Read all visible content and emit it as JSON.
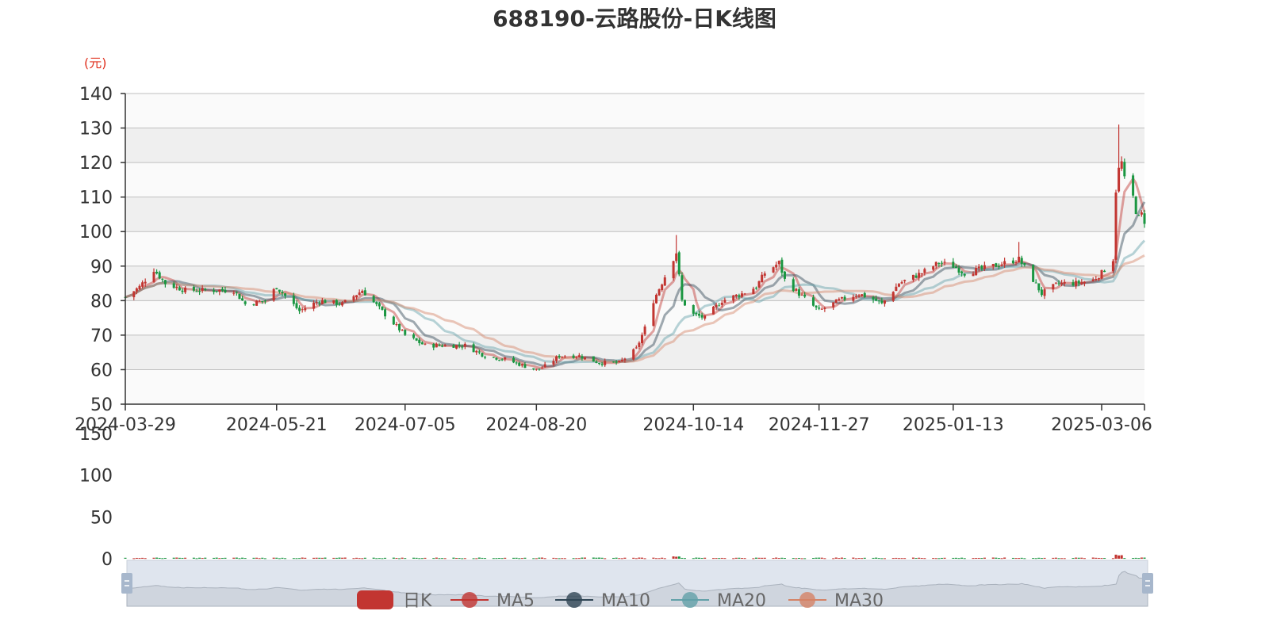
{
  "chart_data": {
    "type": "candlestick",
    "title": "688190-云路股份-日K线图",
    "unit_label": "(元)",
    "price_axis": {
      "min": 50,
      "max": 140,
      "ticks": [
        50,
        60,
        70,
        80,
        90,
        100,
        110,
        120,
        130,
        140
      ]
    },
    "volume_axis": {
      "min": 0,
      "max": 150,
      "ticks": [
        0,
        50,
        100,
        150
      ]
    },
    "date_ticks": [
      "2024-03-29",
      "2024-05-21",
      "2024-07-05",
      "2024-08-20",
      "2024-10-14",
      "2024-11-27",
      "2025-01-13",
      "2025-03-06"
    ],
    "date_range": [
      "2024-03-29",
      "2025-03-21"
    ],
    "background_bands": true,
    "colors": {
      "up": "#c23531",
      "down": "#1a9641",
      "axis": "#333333",
      "grid": "#bfbfbf",
      "band": "#efefef"
    },
    "close_anchors": [
      [
        "2024-03-29",
        81
      ],
      [
        "2024-04-03",
        84
      ],
      [
        "2024-04-08",
        89
      ],
      [
        "2024-04-12",
        85
      ],
      [
        "2024-04-19",
        83
      ],
      [
        "2024-05-06",
        83
      ],
      [
        "2024-05-10",
        79
      ],
      [
        "2024-05-17",
        80
      ],
      [
        "2024-05-21",
        84
      ],
      [
        "2024-05-29",
        77
      ],
      [
        "2024-06-05",
        80
      ],
      [
        "2024-06-13",
        79
      ],
      [
        "2024-06-20",
        83
      ],
      [
        "2024-06-28",
        76
      ],
      [
        "2024-07-05",
        70
      ],
      [
        "2024-07-12",
        67
      ],
      [
        "2024-07-19",
        67
      ],
      [
        "2024-07-26",
        67
      ],
      [
        "2024-08-02",
        64
      ],
      [
        "2024-08-09",
        63
      ],
      [
        "2024-08-16",
        61
      ],
      [
        "2024-08-20",
        60
      ],
      [
        "2024-08-23",
        61
      ],
      [
        "2024-08-28",
        64
      ],
      [
        "2024-09-04",
        64
      ],
      [
        "2024-09-11",
        62
      ],
      [
        "2024-09-18",
        62
      ],
      [
        "2024-09-24",
        66
      ],
      [
        "2024-09-27",
        72
      ],
      [
        "2024-09-30",
        80
      ],
      [
        "2024-10-08",
        94
      ],
      [
        "2024-10-10",
        80
      ],
      [
        "2024-10-14",
        76
      ],
      [
        "2024-10-18",
        75
      ],
      [
        "2024-10-24",
        80
      ],
      [
        "2024-10-31",
        82
      ],
      [
        "2024-11-05",
        84
      ],
      [
        "2024-11-08",
        88
      ],
      [
        "2024-11-13",
        91
      ],
      [
        "2024-11-15",
        86
      ],
      [
        "2024-11-20",
        82
      ],
      [
        "2024-11-27",
        77
      ],
      [
        "2024-12-04",
        80
      ],
      [
        "2024-12-11",
        82
      ],
      [
        "2024-12-17",
        80
      ],
      [
        "2024-12-19",
        79
      ],
      [
        "2024-12-25",
        85
      ],
      [
        "2025-01-02",
        88
      ],
      [
        "2025-01-08",
        91
      ],
      [
        "2025-01-13",
        90
      ],
      [
        "2025-01-17",
        88
      ],
      [
        "2025-01-22",
        89
      ],
      [
        "2025-01-27",
        90
      ],
      [
        "2025-02-05",
        92
      ],
      [
        "2025-02-10",
        86
      ],
      [
        "2025-02-13",
        82
      ],
      [
        "2025-02-19",
        85
      ],
      [
        "2025-02-25",
        85
      ],
      [
        "2025-03-03",
        86
      ],
      [
        "2025-03-06",
        88
      ],
      [
        "2025-03-10",
        92
      ],
      [
        "2025-03-11",
        112
      ],
      [
        "2025-03-12",
        118
      ],
      [
        "2025-03-13",
        120
      ],
      [
        "2025-03-14",
        115
      ],
      [
        "2025-03-17",
        110
      ],
      [
        "2025-03-18",
        106
      ],
      [
        "2025-03-19",
        104
      ],
      [
        "2025-03-20",
        105
      ],
      [
        "2025-03-21",
        103
      ]
    ],
    "spikes": [
      {
        "date": "2024-10-08",
        "high": 99
      },
      {
        "date": "2025-03-12",
        "high": 131
      },
      {
        "date": "2025-02-05",
        "high": 97
      }
    ],
    "volume_highlights": [
      {
        "date": "2024-10-08",
        "value": 4
      },
      {
        "date": "2025-03-12",
        "value": 6
      }
    ],
    "series": [
      {
        "name": "日K",
        "color": "#c23531"
      },
      {
        "name": "MA5",
        "color": "#c23531",
        "period": 5
      },
      {
        "name": "MA10",
        "color": "#2f4554",
        "period": 10
      },
      {
        "name": "MA20",
        "color": "#61a0a8",
        "period": 20
      },
      {
        "name": "MA30",
        "color": "#d48265",
        "period": 30
      }
    ],
    "legend_position": "bottom-center",
    "data_zoom": {
      "start_pct": 0,
      "end_pct": 100
    }
  }
}
